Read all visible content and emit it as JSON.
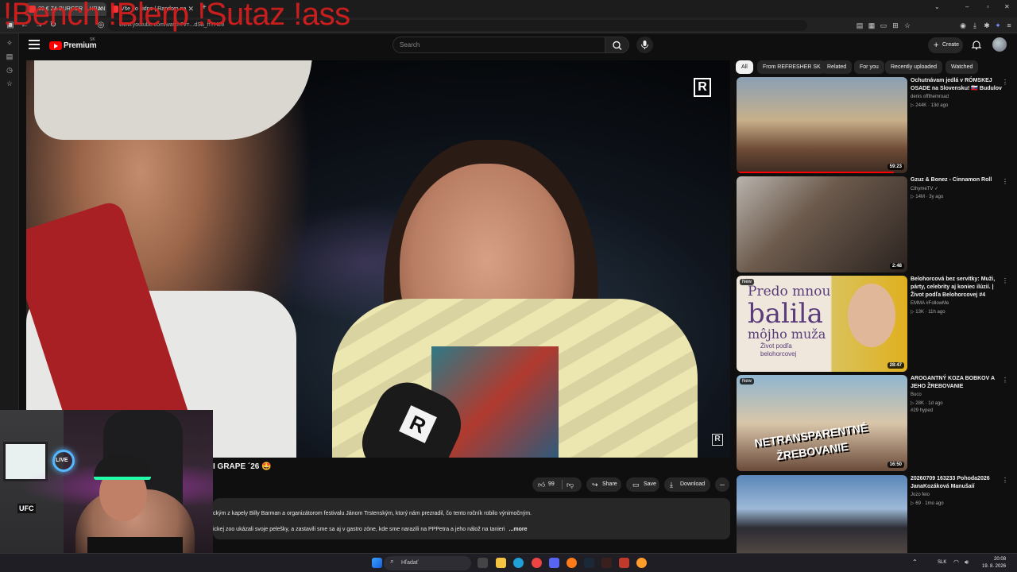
{
  "browser": {
    "tabs": [
      {
        "label": "20 € ZA BURGER S HRAN",
        "active": true
      },
      {
        "label": "Vše do vidne | Random na",
        "active": false
      }
    ],
    "url": "www.youtube.com/watch?v=...dSa_hYH28",
    "overlay_text": "!Bench !Blerp !Sutaz !ass"
  },
  "header": {
    "logo_text": "Premium",
    "logo_region": "SK",
    "search_placeholder": "Search",
    "create_label": "Create"
  },
  "video": {
    "title": "I GRAPE ´26 🤩",
    "watermark": "R",
    "mic_logo": "R",
    "likes": "99",
    "share_label": "Share",
    "save_label": "Save",
    "download_label": "Download",
    "more_label": "...",
    "description_line1": "ckým z kapely Billy Barman a organizátorom festivalu Jánom Trstenským, ktorý nám prezradil, čo tento ročník robilo výnimočným.",
    "description_line2": "ickej zoo ukázali svoje pelešky, a zastavili sme sa aj v gastro zóne, kde sme narazili na PPPetra a jeho nálož na tanieri",
    "description_more": "...more"
  },
  "webcam": {
    "live_label": "LIVE",
    "ufc_label": "UFC"
  },
  "chips": [
    "All",
    "From REFRESHER SK",
    "Related",
    "For you",
    "Recently uploaded",
    "Watched"
  ],
  "recommendations": [
    {
      "title": "Ochutnávam jedlá v RÓMSKEJ OSADE na Slovensku! 🇸🇰 Budulov",
      "channel": "denis offthemroad",
      "meta": "▷ 244K · 13d ago",
      "extra": "",
      "duration": "59:23",
      "new": "",
      "progress": 0.92
    },
    {
      "title": "Gzuz & Bonez - Cinnamon Roll",
      "channel": "CthymeTV ✓",
      "meta": "▷ 14M · 3y ago",
      "extra": "",
      "duration": "2:48",
      "new": "",
      "progress": 0
    },
    {
      "title": "Belohorcová bez servítky: Muži, párty, celebrity aj koniec ilúzií. | Život podľa Belohorcovej #4",
      "channel": "EMMA #FollowMe",
      "meta": "▷ 13K · 11h ago",
      "extra": "",
      "duration": "28:47",
      "new": "New",
      "progress": 0,
      "thumb_text": [
        "Predo mnou",
        "balila",
        "môjho muža",
        "Život podľa",
        "belohorcovej"
      ]
    },
    {
      "title": "AROGANTNÝ KOZA BOBKOV A JEHO ŽREBOVANIE",
      "channel": "Buco",
      "meta": "▷ 28K · 1d ago",
      "extra": "#29 hyped",
      "duration": "16:50",
      "new": "New",
      "progress": 0,
      "thumb_text": [
        "NETRANSPARENTNÉ",
        "ŽREBOVANIE"
      ]
    },
    {
      "title": "20260709 163233 Pohoda2026 JanaKozáková Manušaíí",
      "channel": "Jozo feio",
      "meta": "▷ 69 · 1mo ago",
      "extra": "",
      "duration": "",
      "new": "",
      "progress": 0
    }
  ],
  "taskbar": {
    "search_placeholder": "Hľadať",
    "lang": "SLK",
    "time": "20:08",
    "date": "19. 8. 2026"
  },
  "colors": {
    "yt_red": "#ff0000",
    "overlay_red": "#d21f1f",
    "background": "#0f0f0f"
  }
}
